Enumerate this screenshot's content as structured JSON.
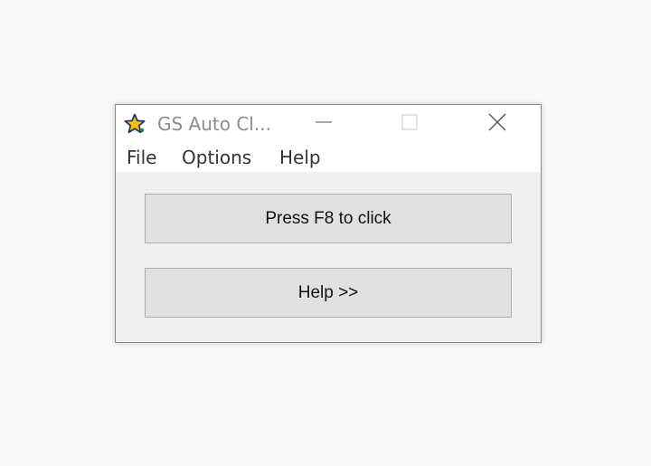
{
  "window": {
    "title": "GS Auto Cl..."
  },
  "icons": {
    "app": "star-icon",
    "minimize": "minimize-icon",
    "maximize": "maximize-icon",
    "close": "close-icon"
  },
  "menu": {
    "items": [
      {
        "label": "File"
      },
      {
        "label": "Options"
      },
      {
        "label": "Help"
      }
    ]
  },
  "buttons": {
    "press": "Press F8 to click",
    "help": "Help >>"
  },
  "colors": {
    "desktop": "#f8f8f8",
    "window_bg": "#f0f0f0",
    "button_bg": "#e1e1e1",
    "star_yellow": "#f5c400",
    "star_outline": "#1f3a7a"
  }
}
